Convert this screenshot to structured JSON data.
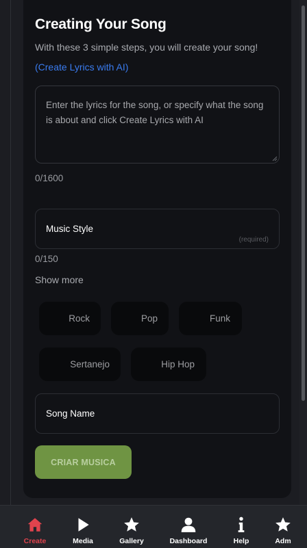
{
  "form": {
    "title": "Creating Your Song",
    "subtitle": "With these 3 simple steps, you will create your song!",
    "ai_link": "(Create Lyrics with AI)",
    "lyrics_placeholder": "Enter the lyrics for the song, or specify what the song is about and click Create Lyrics with AI",
    "lyrics_counter": "0/1600",
    "style_label": "Music Style",
    "style_required": "(required)",
    "style_counter": "0/150",
    "show_more": "Show more",
    "styles": [
      "Rock",
      "Pop",
      "Funk",
      "Sertanejo",
      "Hip Hop"
    ],
    "song_name_label": "Song Name",
    "create_button": "CRIAR MUSICA"
  },
  "nav": {
    "items": [
      {
        "label": "Create",
        "icon": "home-icon",
        "active": true
      },
      {
        "label": "Media",
        "icon": "play-icon",
        "active": false
      },
      {
        "label": "Gallery",
        "icon": "star-icon",
        "active": false
      },
      {
        "label": "Dashboard",
        "icon": "user-icon",
        "active": false
      },
      {
        "label": "Help",
        "icon": "info-icon",
        "active": false
      },
      {
        "label": "Adm",
        "icon": "star-icon",
        "active": false
      }
    ]
  },
  "colors": {
    "accent_active": "#e0434d",
    "link": "#3a7cf0",
    "create_button": "#6f9443",
    "card": "#111216",
    "page": "#1c1d22"
  }
}
